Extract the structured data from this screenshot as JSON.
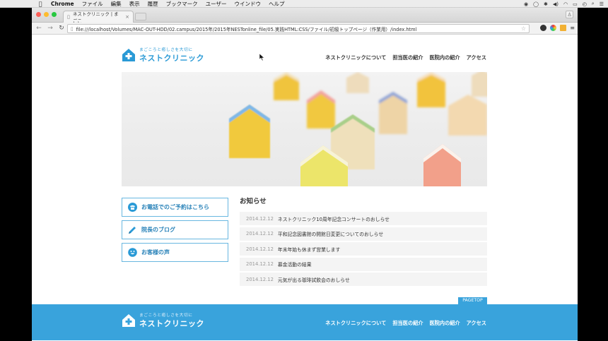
{
  "menubar": {
    "app": "Chrome",
    "items": [
      "ファイル",
      "編集",
      "表示",
      "履歴",
      "ブックマーク",
      "ユーザー",
      "ウインドウ",
      "ヘルプ"
    ]
  },
  "browser": {
    "tab_title": "ネストクリニック | まごこ",
    "url": "file:///localhost/Volumes/MAC-OUT-HDD/02.campus/2015年/2015年NESTonline_file/05.実践HTML:CSS/ファイル/初級トップページ（作業用）/index.html"
  },
  "site": {
    "tagline": "まごころと癒しさを大切に",
    "name": "ネストクリニック",
    "nav": [
      "ネストクリニックについて",
      "担当医の紹介",
      "医院内の紹介",
      "アクセス"
    ]
  },
  "sidebar": {
    "buttons": [
      {
        "label": "お電話でのご予約はこちら",
        "icon": "phone-icon"
      },
      {
        "label": "院長のブログ",
        "icon": "pencil-icon"
      },
      {
        "label": "お客様の声",
        "icon": "smiley-icon"
      }
    ]
  },
  "news": {
    "title": "お知らせ",
    "items": [
      {
        "date": "2014.12.12",
        "text": "ネストクリニック10周年記念コンサートのおしらせ"
      },
      {
        "date": "2014.12.12",
        "text": "平和記念図書館の開館日変更についてのおしらせ"
      },
      {
        "date": "2014.12.12",
        "text": "年末年始も休まず営業します"
      },
      {
        "date": "2014.12.12",
        "text": "募金活動の結果"
      },
      {
        "date": "2014.12.12",
        "text": "元気が出る珈琲試飲会のおしらせ"
      }
    ]
  },
  "pagetop": "PAGETOP",
  "footer": {
    "tagline": "まごころと癒しさを大切に",
    "name": "ネストクリニック",
    "nav": [
      "ネストクリニックについて",
      "担当医の紹介",
      "医院内の紹介",
      "アクセス"
    ]
  },
  "colors": {
    "brand": "#2a9ad6",
    "footer": "#39a3dc",
    "border": "#69b7e0"
  }
}
